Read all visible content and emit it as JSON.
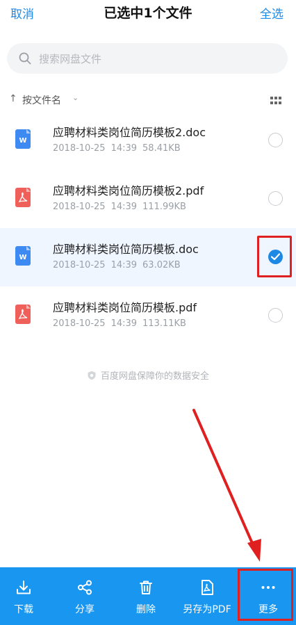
{
  "header": {
    "cancel": "取消",
    "title": "已选中1个文件",
    "select_all": "全选"
  },
  "search": {
    "placeholder": "搜索网盘文件"
  },
  "sort": {
    "arrow": "↑",
    "label": "按文件名",
    "chevron": "⌄"
  },
  "files": [
    {
      "name": "应聘材料类岗位简历模板2.doc",
      "date": "2018-10-25",
      "time": "14:39",
      "size": "58.41KB",
      "type": "doc",
      "selected": false
    },
    {
      "name": "应聘材料类岗位简历模板2.pdf",
      "date": "2018-10-25",
      "time": "14:39",
      "size": "111.99KB",
      "type": "pdf",
      "selected": false
    },
    {
      "name": "应聘材料类岗位简历模板.doc",
      "date": "2018-10-25",
      "time": "14:39",
      "size": "63.02KB",
      "type": "doc",
      "selected": true
    },
    {
      "name": "应聘材料类岗位简历模板.pdf",
      "date": "2018-10-25",
      "time": "14:39",
      "size": "113.11KB",
      "type": "pdf",
      "selected": false
    }
  ],
  "security_note": "百度网盘保障你的数据安全",
  "toolbar": {
    "download": "下载",
    "share": "分享",
    "delete": "删除",
    "save_pdf": "另存为PDF",
    "more": "更多"
  },
  "colors": {
    "accent": "#1e88e5",
    "toolbar": "#1996f0",
    "doc_icon": "#3d8bf2",
    "pdf_icon": "#f0605a",
    "annotation": "#e02020"
  }
}
